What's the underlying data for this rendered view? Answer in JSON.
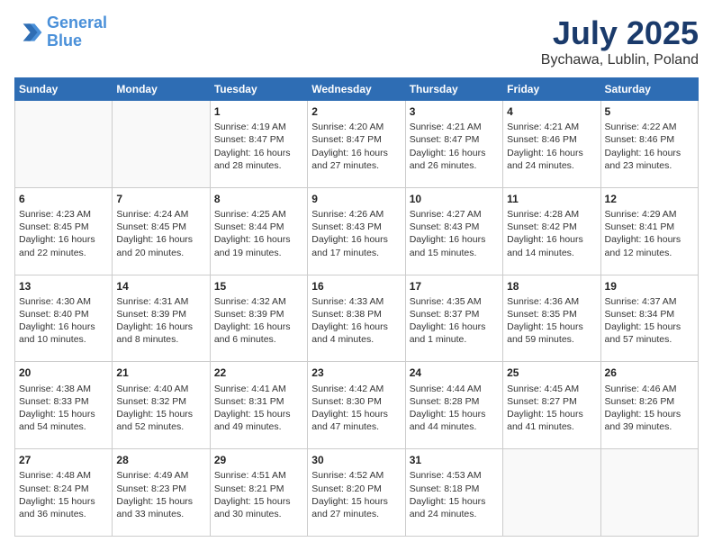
{
  "header": {
    "logo_line1": "General",
    "logo_line2": "Blue",
    "title": "July 2025",
    "subtitle": "Bychawa, Lublin, Poland"
  },
  "calendar": {
    "headers": [
      "Sunday",
      "Monday",
      "Tuesday",
      "Wednesday",
      "Thursday",
      "Friday",
      "Saturday"
    ],
    "weeks": [
      [
        {
          "day": "",
          "content": ""
        },
        {
          "day": "",
          "content": ""
        },
        {
          "day": "1",
          "content": "Sunrise: 4:19 AM\nSunset: 8:47 PM\nDaylight: 16 hours\nand 28 minutes."
        },
        {
          "day": "2",
          "content": "Sunrise: 4:20 AM\nSunset: 8:47 PM\nDaylight: 16 hours\nand 27 minutes."
        },
        {
          "day": "3",
          "content": "Sunrise: 4:21 AM\nSunset: 8:47 PM\nDaylight: 16 hours\nand 26 minutes."
        },
        {
          "day": "4",
          "content": "Sunrise: 4:21 AM\nSunset: 8:46 PM\nDaylight: 16 hours\nand 24 minutes."
        },
        {
          "day": "5",
          "content": "Sunrise: 4:22 AM\nSunset: 8:46 PM\nDaylight: 16 hours\nand 23 minutes."
        }
      ],
      [
        {
          "day": "6",
          "content": "Sunrise: 4:23 AM\nSunset: 8:45 PM\nDaylight: 16 hours\nand 22 minutes."
        },
        {
          "day": "7",
          "content": "Sunrise: 4:24 AM\nSunset: 8:45 PM\nDaylight: 16 hours\nand 20 minutes."
        },
        {
          "day": "8",
          "content": "Sunrise: 4:25 AM\nSunset: 8:44 PM\nDaylight: 16 hours\nand 19 minutes."
        },
        {
          "day": "9",
          "content": "Sunrise: 4:26 AM\nSunset: 8:43 PM\nDaylight: 16 hours\nand 17 minutes."
        },
        {
          "day": "10",
          "content": "Sunrise: 4:27 AM\nSunset: 8:43 PM\nDaylight: 16 hours\nand 15 minutes."
        },
        {
          "day": "11",
          "content": "Sunrise: 4:28 AM\nSunset: 8:42 PM\nDaylight: 16 hours\nand 14 minutes."
        },
        {
          "day": "12",
          "content": "Sunrise: 4:29 AM\nSunset: 8:41 PM\nDaylight: 16 hours\nand 12 minutes."
        }
      ],
      [
        {
          "day": "13",
          "content": "Sunrise: 4:30 AM\nSunset: 8:40 PM\nDaylight: 16 hours\nand 10 minutes."
        },
        {
          "day": "14",
          "content": "Sunrise: 4:31 AM\nSunset: 8:39 PM\nDaylight: 16 hours\nand 8 minutes."
        },
        {
          "day": "15",
          "content": "Sunrise: 4:32 AM\nSunset: 8:39 PM\nDaylight: 16 hours\nand 6 minutes."
        },
        {
          "day": "16",
          "content": "Sunrise: 4:33 AM\nSunset: 8:38 PM\nDaylight: 16 hours\nand 4 minutes."
        },
        {
          "day": "17",
          "content": "Sunrise: 4:35 AM\nSunset: 8:37 PM\nDaylight: 16 hours\nand 1 minute."
        },
        {
          "day": "18",
          "content": "Sunrise: 4:36 AM\nSunset: 8:35 PM\nDaylight: 15 hours\nand 59 minutes."
        },
        {
          "day": "19",
          "content": "Sunrise: 4:37 AM\nSunset: 8:34 PM\nDaylight: 15 hours\nand 57 minutes."
        }
      ],
      [
        {
          "day": "20",
          "content": "Sunrise: 4:38 AM\nSunset: 8:33 PM\nDaylight: 15 hours\nand 54 minutes."
        },
        {
          "day": "21",
          "content": "Sunrise: 4:40 AM\nSunset: 8:32 PM\nDaylight: 15 hours\nand 52 minutes."
        },
        {
          "day": "22",
          "content": "Sunrise: 4:41 AM\nSunset: 8:31 PM\nDaylight: 15 hours\nand 49 minutes."
        },
        {
          "day": "23",
          "content": "Sunrise: 4:42 AM\nSunset: 8:30 PM\nDaylight: 15 hours\nand 47 minutes."
        },
        {
          "day": "24",
          "content": "Sunrise: 4:44 AM\nSunset: 8:28 PM\nDaylight: 15 hours\nand 44 minutes."
        },
        {
          "day": "25",
          "content": "Sunrise: 4:45 AM\nSunset: 8:27 PM\nDaylight: 15 hours\nand 41 minutes."
        },
        {
          "day": "26",
          "content": "Sunrise: 4:46 AM\nSunset: 8:26 PM\nDaylight: 15 hours\nand 39 minutes."
        }
      ],
      [
        {
          "day": "27",
          "content": "Sunrise: 4:48 AM\nSunset: 8:24 PM\nDaylight: 15 hours\nand 36 minutes."
        },
        {
          "day": "28",
          "content": "Sunrise: 4:49 AM\nSunset: 8:23 PM\nDaylight: 15 hours\nand 33 minutes."
        },
        {
          "day": "29",
          "content": "Sunrise: 4:51 AM\nSunset: 8:21 PM\nDaylight: 15 hours\nand 30 minutes."
        },
        {
          "day": "30",
          "content": "Sunrise: 4:52 AM\nSunset: 8:20 PM\nDaylight: 15 hours\nand 27 minutes."
        },
        {
          "day": "31",
          "content": "Sunrise: 4:53 AM\nSunset: 8:18 PM\nDaylight: 15 hours\nand 24 minutes."
        },
        {
          "day": "",
          "content": ""
        },
        {
          "day": "",
          "content": ""
        }
      ]
    ]
  }
}
